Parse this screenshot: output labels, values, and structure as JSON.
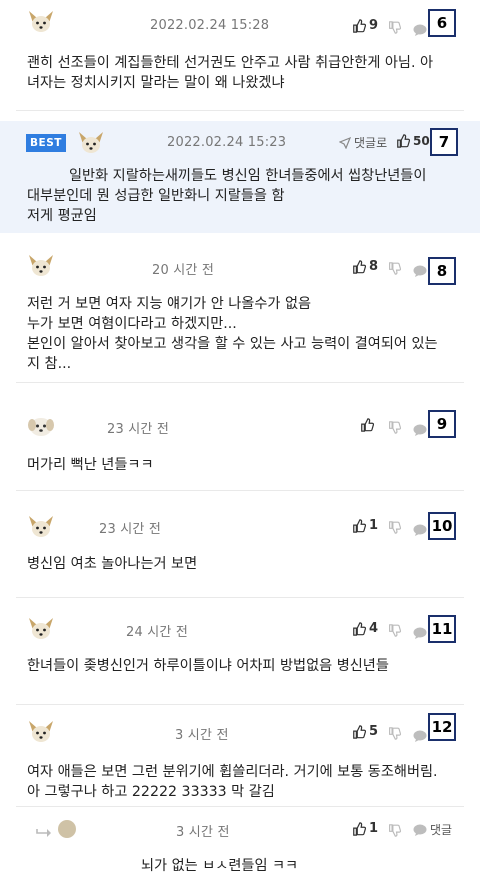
{
  "comments": [
    {
      "id": "c6",
      "rank": "6",
      "time": "2022.02.24 15:28",
      "likes": "9",
      "lines": [
        "괜히 선조들이 계집들한테 선거권도 안주고 사람 취급안한게 아님. 아",
        "녀자는 정치시키지 말라는 말이 왜 나왔겠냐"
      ]
    },
    {
      "id": "c7",
      "rank": "7",
      "best_label": "BEST",
      "time": "2022.02.24 15:23",
      "reply_label": "댓글로",
      "likes": "50",
      "lines": [
        "일반화 지랄하는새끼들도 병신임 한녀들중에서 씹창난년들이",
        "대부분인데 뭔 성급한 일반화니 지랄들을 함",
        "저게 평균임"
      ]
    },
    {
      "id": "c8",
      "rank": "8",
      "time": "20 시간 전",
      "likes": "8",
      "lines": [
        "저런 거 보면 여자 지능 얘기가 안 나올수가 없음",
        "누가 보면 여혐이다라고 하겠지만...",
        "본인이 알아서 찾아보고 생각을 할 수 있는 사고 능력이 결여되어 있는",
        "지 참..."
      ]
    },
    {
      "id": "c9",
      "rank": "9",
      "time": "23 시간 전",
      "likes": "",
      "lines": [
        "머가리 뻑난 년들ㅋㅋ"
      ]
    },
    {
      "id": "c10",
      "rank": "10",
      "time": "23 시간 전",
      "likes": "1",
      "lines": [
        "병신임 여초 놀아나는거 보면"
      ]
    },
    {
      "id": "c11",
      "rank": "11",
      "time": "24 시간 전",
      "likes": "4",
      "lines": [
        "한녀들이 좆병신인거 하루이틀이냐 어차피 방법없음 병신년들"
      ]
    },
    {
      "id": "c12",
      "rank": "12",
      "time": "3 시간 전",
      "likes": "5",
      "lines": [
        "여자 애들은 보면 그런 분위기에 휩쓸리더라. 거기에 보통 동조해버림.",
        "아 그렇구나 하고 22222 33333 막 갈김"
      ]
    }
  ],
  "reply": {
    "time": "3 시간 전",
    "likes": "1",
    "reply_label": "댓글",
    "lines": [
      "뇌가 없는 ㅂㅅ련들임 ㅋㅋ"
    ]
  },
  "colors": {
    "best_bg": "#eef3fb",
    "best_badge": "#2f7de0",
    "rank_border": "#1a2f6b"
  }
}
